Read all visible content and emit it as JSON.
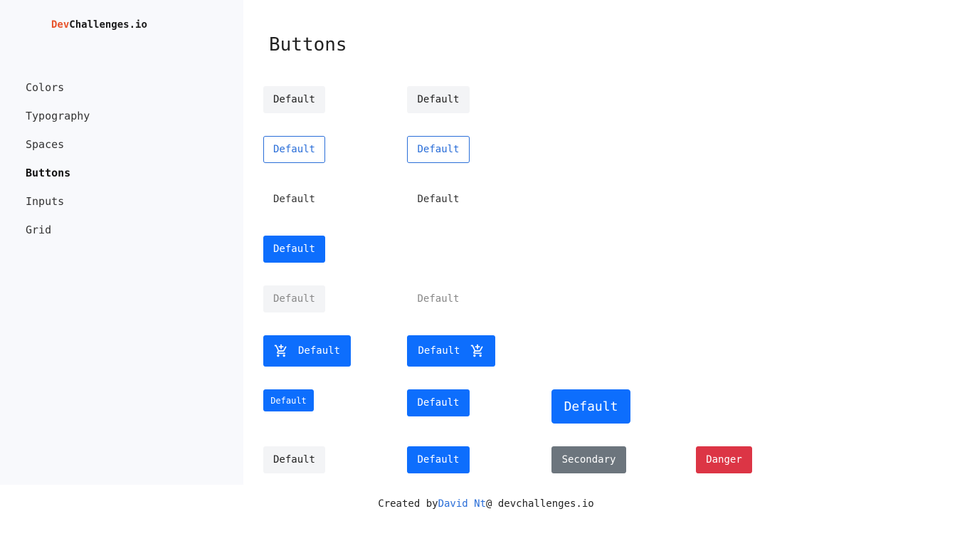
{
  "logo": {
    "accent": "Dev",
    "rest": "Challenges.io"
  },
  "nav": {
    "items": [
      {
        "label": "Colors"
      },
      {
        "label": "Typography"
      },
      {
        "label": "Spaces"
      },
      {
        "label": "Buttons"
      },
      {
        "label": "Inputs"
      },
      {
        "label": "Grid"
      }
    ],
    "active": "Buttons"
  },
  "main": {
    "title": "Buttons"
  },
  "buttons": {
    "default_1": "Default",
    "default_2": "Default",
    "outline_1": "Default",
    "outline_2": "Default",
    "text_1": "Default",
    "text_2": "Default",
    "primary_1": "Default",
    "disabled_1": "Default",
    "disabled_2": "Default",
    "cart_start": "Default",
    "cart_end": "Default",
    "small": "Default",
    "medium": "Default",
    "large": "Default",
    "final_default": "Default",
    "final_primary": "Default",
    "secondary": "Secondary",
    "danger": "Danger"
  },
  "footer": {
    "prefix": "Created by",
    "author": "David Nt",
    "suffix": "@ devchallenges.io"
  },
  "colors": {
    "primary": "#0d6efd",
    "secondary": "#6c757d",
    "danger": "#dc3545",
    "logo_accent": "#e8552d",
    "sidebar_bg": "#f8f9fc"
  },
  "icons": {
    "cart": "add-shopping-cart-icon"
  }
}
